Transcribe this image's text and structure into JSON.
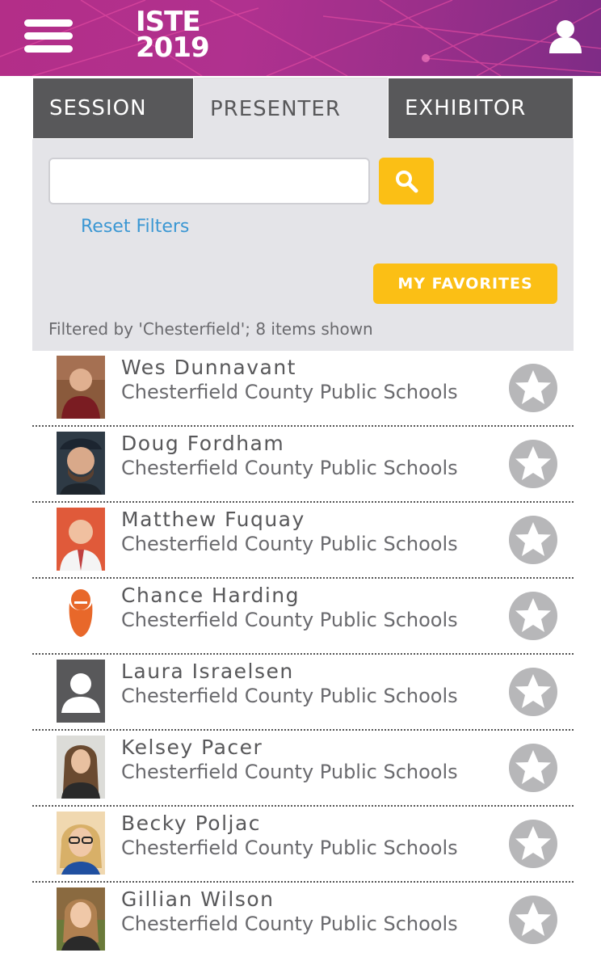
{
  "header": {
    "logo_line1": "ISTE",
    "logo_line2": "2019",
    "menu_icon": "hamburger-menu-icon",
    "user_icon": "user-icon"
  },
  "tabs": [
    {
      "label": "SESSION",
      "active": false
    },
    {
      "label": "PRESENTER",
      "active": true
    },
    {
      "label": "EXHIBITOR",
      "active": false
    }
  ],
  "filters": {
    "search_value": "",
    "search_placeholder": "",
    "reset_label": "Reset Filters",
    "favorites_label": "MY FAVORITES",
    "status_text": "Filtered by 'Chesterfield'; 8 items shown"
  },
  "presenters": [
    {
      "name": "Wes Dunnavant",
      "org": "Chesterfield County Public Schools",
      "favorited": false
    },
    {
      "name": "Doug Fordham",
      "org": "Chesterfield County Public Schools",
      "favorited": false
    },
    {
      "name": "Matthew Fuquay",
      "org": "Chesterfield County Public Schools",
      "favorited": false
    },
    {
      "name": "Chance Harding",
      "org": "Chesterfield County Public Schools",
      "favorited": false
    },
    {
      "name": "Laura Israelsen",
      "org": "Chesterfield County Public Schools",
      "favorited": false
    },
    {
      "name": "Kelsey Pacer",
      "org": "Chesterfield County Public Schools",
      "favorited": false
    },
    {
      "name": "Becky Poljac",
      "org": "Chesterfield County Public Schools",
      "favorited": false
    },
    {
      "name": "Gillian Wilson",
      "org": "Chesterfield County Public Schools",
      "favorited": false
    }
  ],
  "colors": {
    "header": "#b0318f",
    "accent_yellow": "#fbbf15",
    "tab_dark": "#58585a",
    "panel_bg": "#e4e4e8",
    "link_blue": "#3b97d3",
    "star_gray": "#b7b7b9"
  }
}
